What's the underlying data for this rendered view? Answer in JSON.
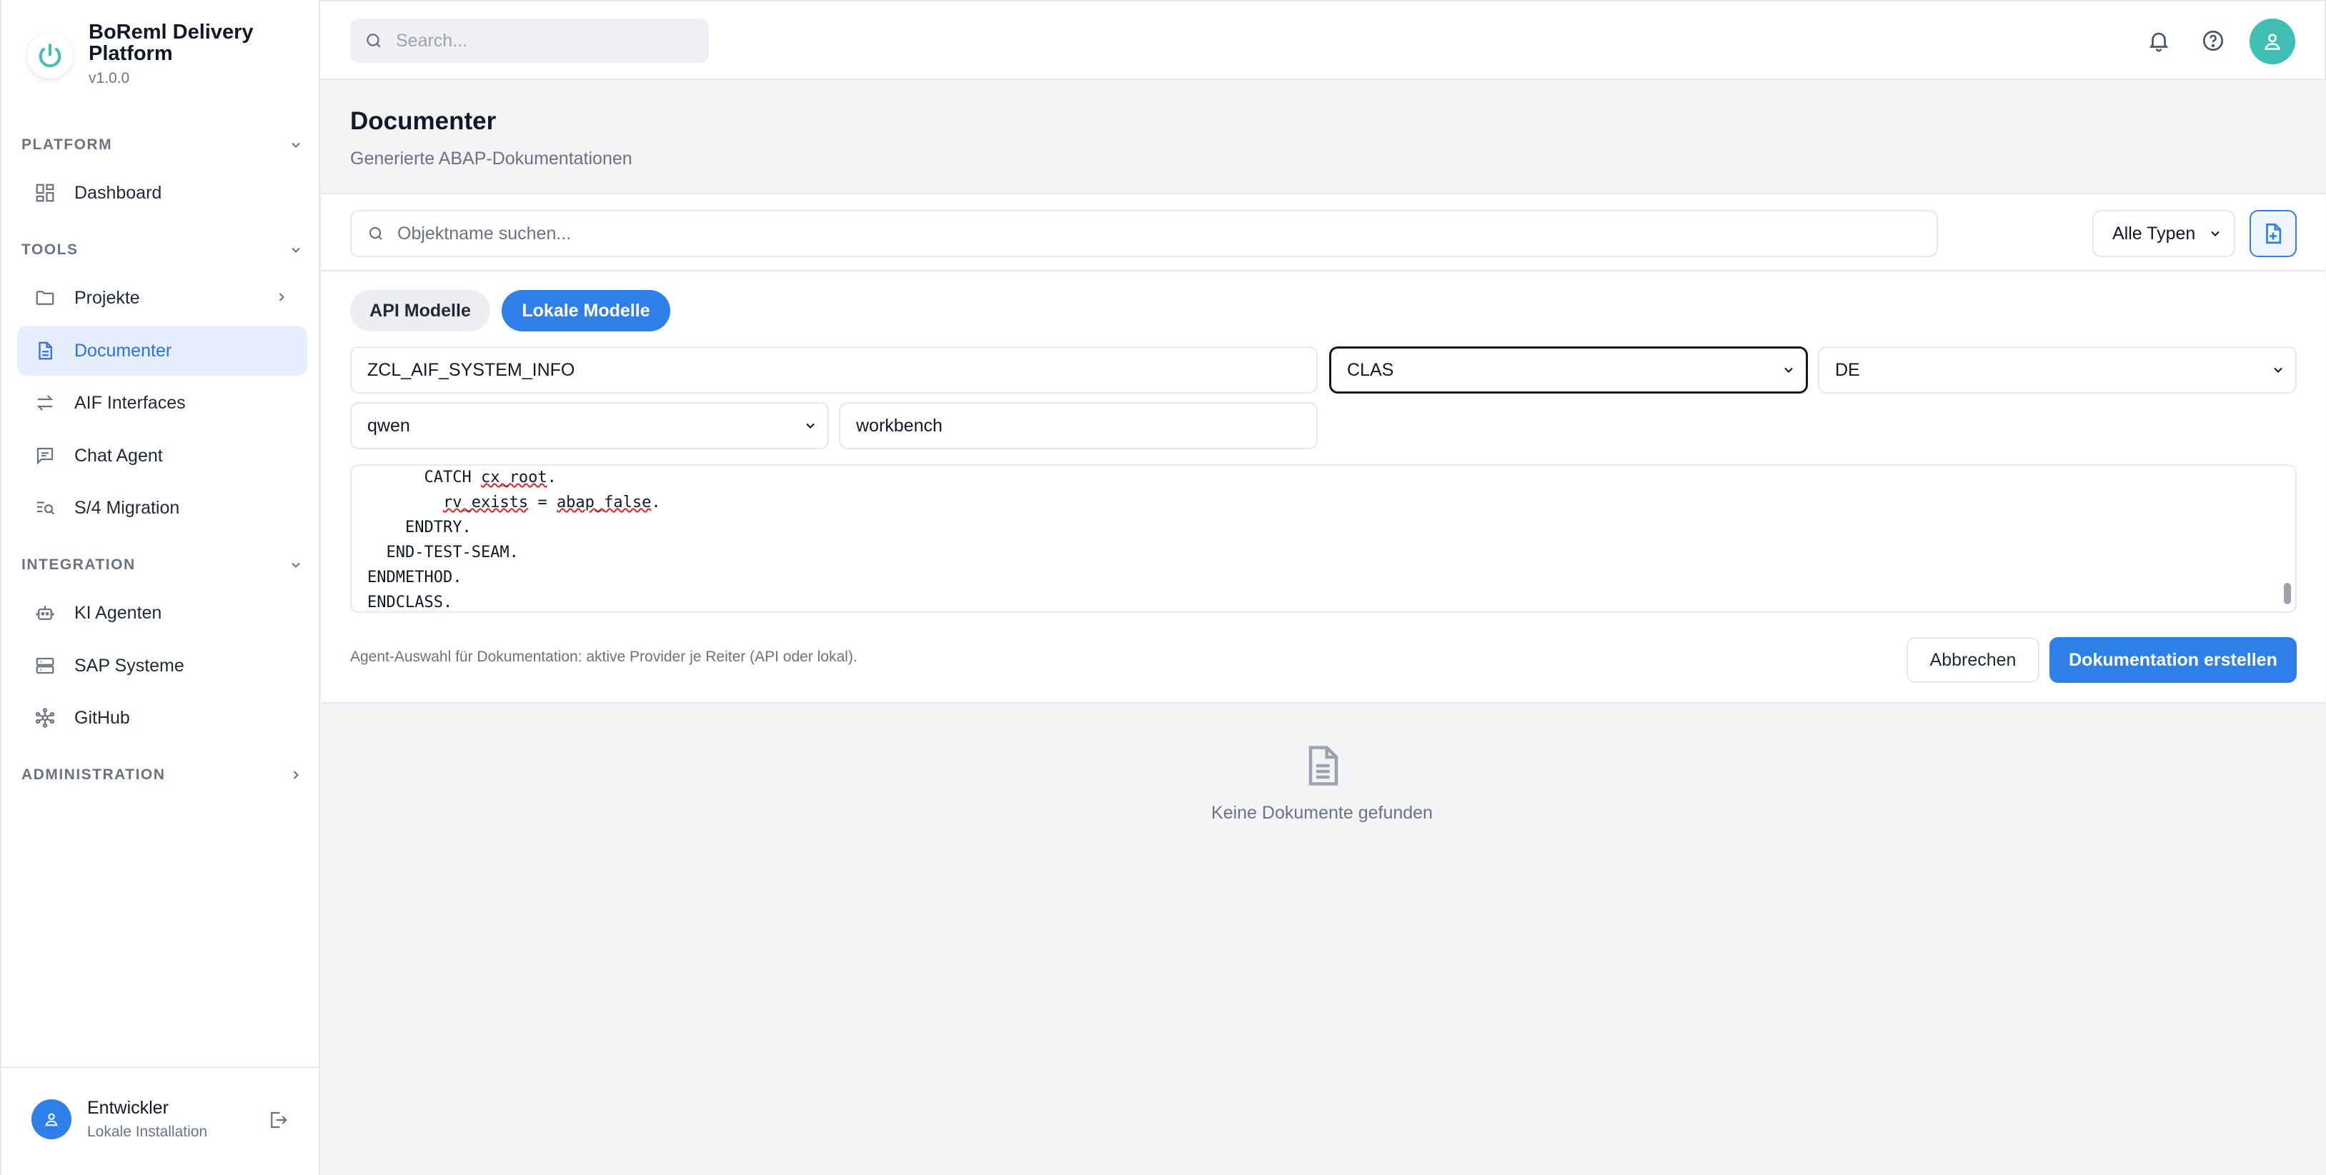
{
  "app": {
    "name": "BoReml Delivery Platform",
    "version": "v1.0.0"
  },
  "sidebar": {
    "sections": [
      {
        "label": "PLATFORM",
        "items": [
          {
            "label": "Dashboard",
            "icon": "dashboard-icon"
          }
        ]
      },
      {
        "label": "TOOLS",
        "items": [
          {
            "label": "Projekte",
            "icon": "folder-icon"
          },
          {
            "label": "Documenter",
            "icon": "document-icon",
            "active": true
          },
          {
            "label": "AIF Interfaces",
            "icon": "arrows-exchange-icon"
          },
          {
            "label": "Chat Agent",
            "icon": "chat-icon"
          },
          {
            "label": "S/4 Migration",
            "icon": "list-search-icon"
          }
        ]
      },
      {
        "label": "INTEGRATION",
        "items": [
          {
            "label": "KI Agenten",
            "icon": "robot-icon"
          },
          {
            "label": "SAP Systeme",
            "icon": "server-icon"
          },
          {
            "label": "GitHub",
            "icon": "network-icon"
          }
        ]
      },
      {
        "label": "ADMINISTRATION",
        "items": []
      }
    ],
    "user": {
      "name": "Entwickler",
      "subtitle": "Lokale Installation"
    }
  },
  "topbar": {
    "search_placeholder": "Search..."
  },
  "page": {
    "title": "Documenter",
    "subtitle": "Generierte ABAP-Dokumentationen"
  },
  "filters": {
    "search_placeholder": "Objektname suchen...",
    "type_filter": "Alle Typen"
  },
  "form": {
    "tabs": [
      "API Modelle",
      "Lokale Modelle"
    ],
    "active_tab": "Lokale Modelle",
    "object_name": "ZCL_AIF_SYSTEM_INFO",
    "object_type": "CLAS",
    "language": "DE",
    "model": "qwen",
    "package": "workbench",
    "code_lines": [
      "      CATCH cx_root.",
      "        rv_exists = abap_false.",
      "    ENDTRY.",
      "  END-TEST-SEAM.",
      "ENDMETHOD.",
      "ENDCLASS."
    ],
    "hint": "Agent-Auswahl für Dokumentation: aktive Provider je Reiter (API oder lokal).",
    "cancel_label": "Abbrechen",
    "submit_label": "Dokumentation erstellen"
  },
  "empty_state": {
    "text": "Keine Dokumente gefunden"
  },
  "colors": {
    "accent": "#2f7fe8",
    "active_bg": "#e4eefc",
    "avatar_teal": "#3fbfb3"
  }
}
